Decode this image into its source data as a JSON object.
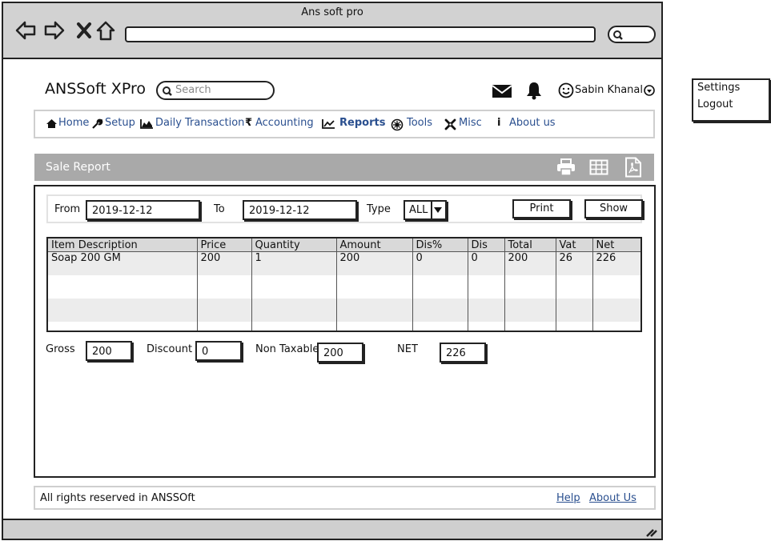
{
  "window": {
    "title": "Ans soft pro"
  },
  "app": {
    "title": "ANSSoft XPro",
    "search_placeholder": "Search",
    "user_name": "Sabin Khanal"
  },
  "menu": [
    {
      "label": "Home",
      "icon": "home-icon"
    },
    {
      "label": "Setup",
      "icon": "wrench-icon"
    },
    {
      "label": "Daily Transaction",
      "icon": "area-chart-icon"
    },
    {
      "label": "Accounting",
      "icon": "rupee-icon"
    },
    {
      "label": "Reports",
      "icon": "line-chart-icon",
      "active": true
    },
    {
      "label": "Tools",
      "icon": "cog-icon"
    },
    {
      "label": "Misc",
      "icon": "joomla-icon"
    },
    {
      "label": "About us",
      "icon": "info-icon"
    }
  ],
  "section": {
    "title": "Sale Report"
  },
  "filters": {
    "from_label": "From",
    "from_value": "2019-12-12",
    "to_label": "To",
    "to_value": "2019-12-12",
    "type_label": "Type",
    "type_value": "ALL",
    "print_label": "Print",
    "show_label": "Show"
  },
  "table": {
    "headers": [
      "Item Description",
      "Price",
      "Quantity",
      "Amount",
      "Dis%",
      "Dis",
      "Total",
      "Vat",
      "Net"
    ],
    "rows": [
      [
        "Soap 200 GM",
        "200",
        "1",
        "200",
        "0",
        "0",
        "200",
        "26",
        "226"
      ]
    ]
  },
  "totals": {
    "gross_label": "Gross",
    "gross_value": "200",
    "discount_label": "Discount",
    "discount_value": "0",
    "non_taxable_label": "Non Taxable",
    "non_taxable_value": "200",
    "net_label": "NET",
    "net_value": "226"
  },
  "footer": {
    "text": "All rights reserved in ANSSOft",
    "help": "Help",
    "about": "About Us"
  },
  "popup": {
    "items": [
      "Settings",
      "Logout"
    ]
  },
  "colors": {
    "link": "#2a4f8f",
    "section_bar": "#a9a9a9",
    "chrome": "#d2d2d2"
  }
}
